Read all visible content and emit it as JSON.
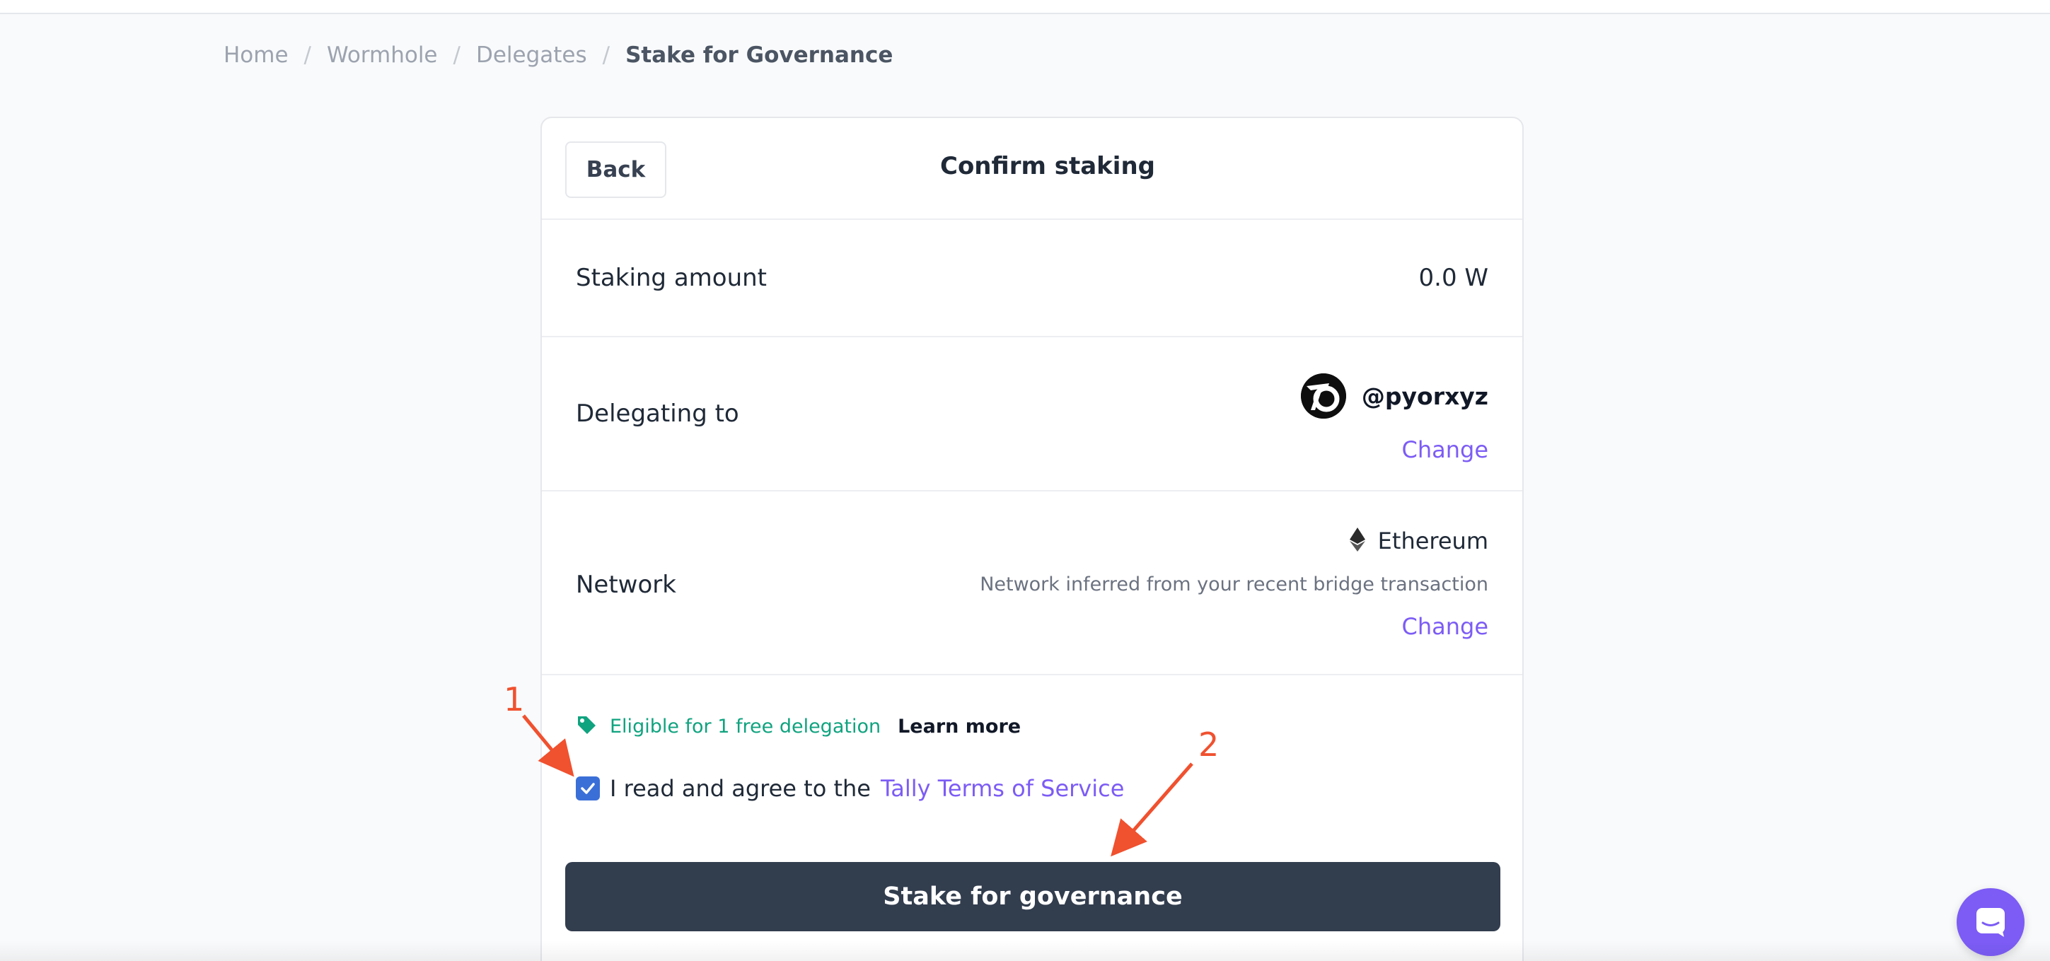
{
  "breadcrumb": {
    "items": [
      "Home",
      "Wormhole",
      "Delegates"
    ],
    "separator": "/",
    "current": "Stake for Governance"
  },
  "card": {
    "back_label": "Back",
    "title": "Confirm staking",
    "staking_amount": {
      "label": "Staking amount",
      "value": "0.0 W"
    },
    "delegating": {
      "label": "Delegating to",
      "handle": "@pyorxyz",
      "change_label": "Change"
    },
    "network": {
      "label": "Network",
      "name": "Ethereum",
      "note": "Network inferred from your recent bridge transaction",
      "change_label": "Change"
    },
    "eligible": {
      "text": "Eligible for 1 free delegation",
      "learn_more": "Learn more"
    },
    "agree": {
      "text": "I read and agree to the",
      "link": "Tally Terms of Service",
      "checked": true
    },
    "stake_button": "Stake for governance"
  },
  "annotations": {
    "one": "1",
    "two": "2",
    "color": "#f0512f"
  },
  "colors": {
    "accent": "#7c5cf5",
    "success": "#10a37f",
    "button": "#323d4e",
    "checkbox": "#3b6fd8"
  }
}
